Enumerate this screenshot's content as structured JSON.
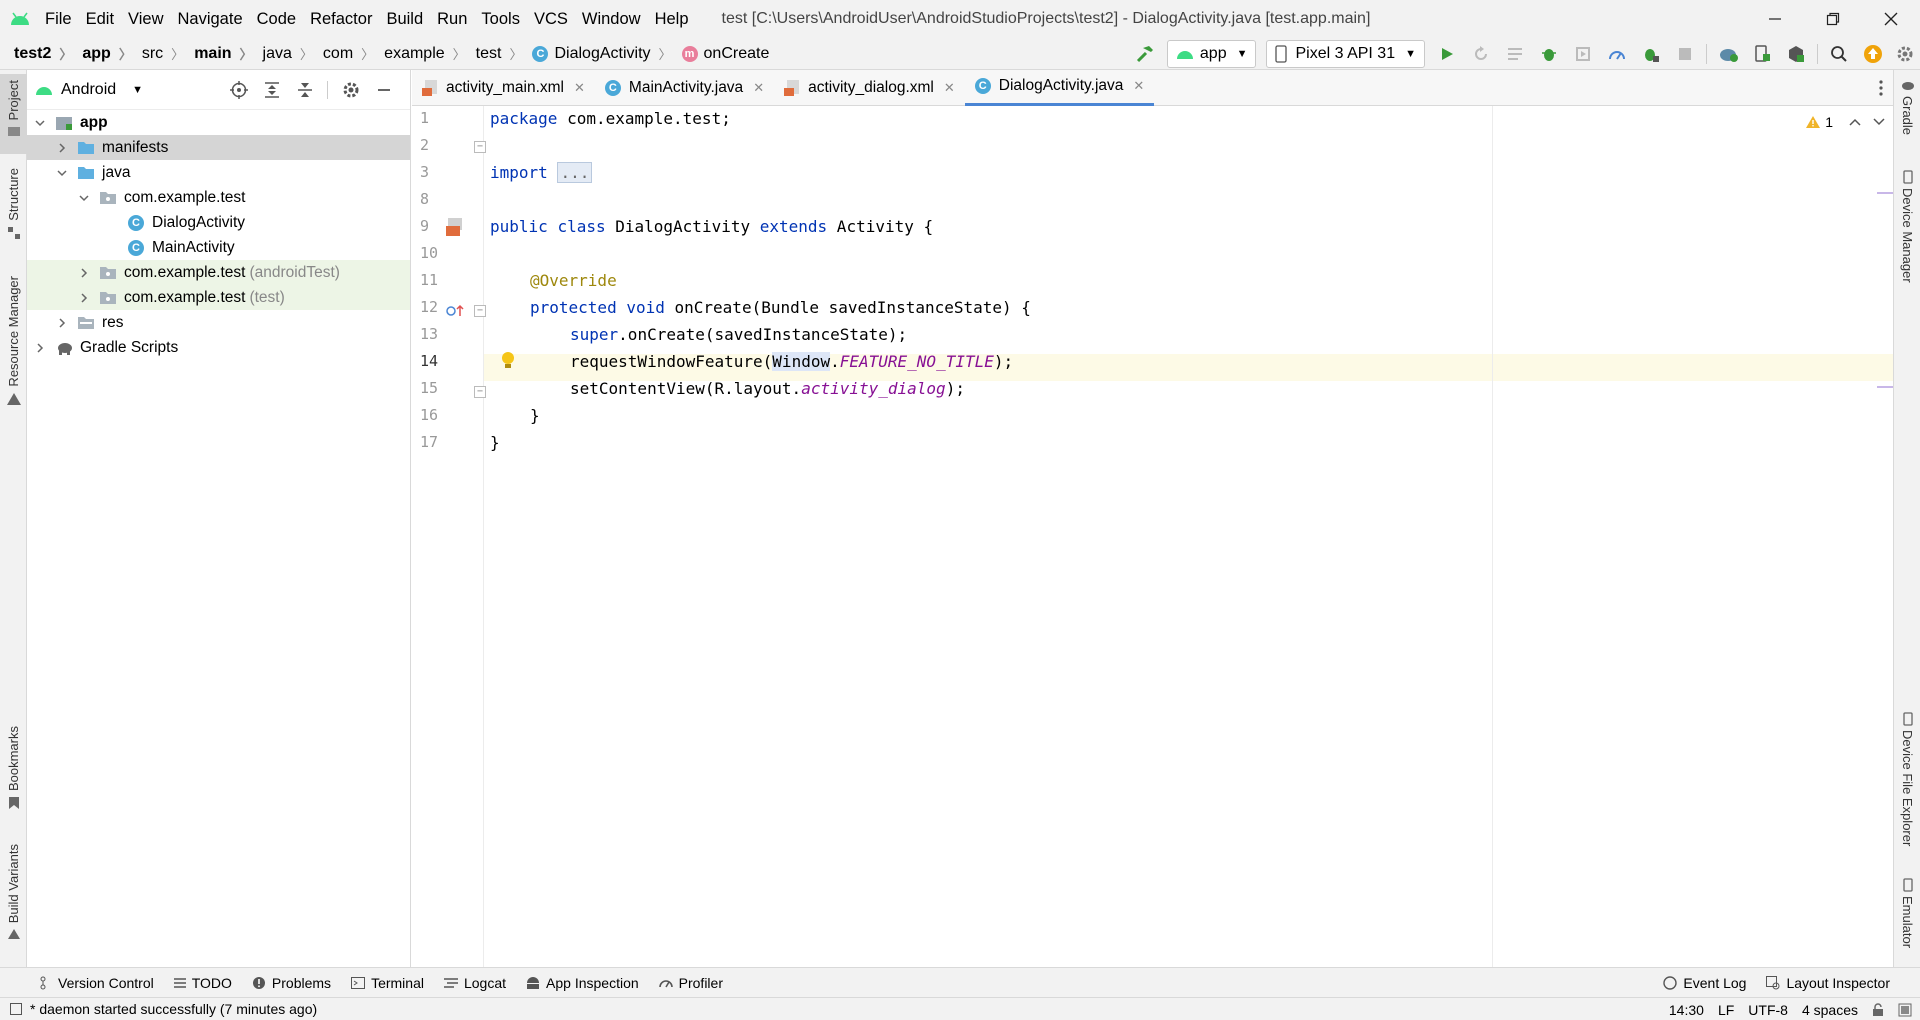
{
  "window": {
    "title": "test [C:\\Users\\AndroidUser\\AndroidStudioProjects\\test2] - DialogActivity.java [test.app.main]",
    "menu": [
      "File",
      "Edit",
      "View",
      "Navigate",
      "Code",
      "Refactor",
      "Build",
      "Run",
      "Tools",
      "VCS",
      "Window",
      "Help"
    ]
  },
  "breadcrumb": [
    "test2",
    "app",
    "src",
    "main",
    "java",
    "com",
    "example",
    "test",
    "DialogActivity",
    "onCreate"
  ],
  "toolbar": {
    "run_config": "app",
    "device": "Pixel 3 API 31"
  },
  "left_strip": {
    "project": "Project",
    "structure": "Structure",
    "resource_manager": "Resource Manager",
    "bookmarks": "Bookmarks",
    "build_variants": "Build Variants"
  },
  "right_strip": {
    "gradle": "Gradle",
    "device_manager": "Device Manager",
    "device_file_explorer": "Device File Explorer",
    "emulator": "Emulator"
  },
  "project_panel": {
    "view_name": "Android",
    "tree": [
      {
        "label": "app",
        "suffix": ""
      },
      {
        "label": "manifests",
        "suffix": ""
      },
      {
        "label": "java",
        "suffix": ""
      },
      {
        "label": "com.example.test",
        "suffix": ""
      },
      {
        "label": "DialogActivity",
        "suffix": ""
      },
      {
        "label": "MainActivity",
        "suffix": ""
      },
      {
        "label": "com.example.test",
        "suffix": "(androidTest)"
      },
      {
        "label": "com.example.test",
        "suffix": "(test)"
      },
      {
        "label": "res",
        "suffix": ""
      },
      {
        "label": "Gradle Scripts",
        "suffix": ""
      }
    ]
  },
  "editor_tabs": [
    "activity_main.xml",
    "MainActivity.java",
    "activity_dialog.xml",
    "DialogActivity.java"
  ],
  "editor": {
    "line_numbers": [
      "1",
      "2",
      "3",
      "8",
      "9",
      "10",
      "11",
      "12",
      "13",
      "14",
      "15",
      "16",
      "17"
    ],
    "code": {
      "l1_kw": "package",
      "l1_rest": " com.example.test;",
      "l3_kw": "import",
      "l3_fold": "...",
      "l9_kw1": "public",
      "l9_kw2": "class",
      "l9_mid": " DialogActivity ",
      "l9_kw3": "extends",
      "l9_rest": " Activity {",
      "l11_ann": "@Override",
      "l12_kw1": "protected",
      "l12_kw2": "void",
      "l12_rest": " onCreate(Bundle savedInstanceState) {",
      "l13_kw": "super",
      "l13_rest": ".onCreate(savedInstanceState);",
      "l14_a": "requestWindowFeature(",
      "l14_b": "Window",
      "l14_c": ".",
      "l14_fld": "FEATURE_NO_TITLE",
      "l14_d": ");",
      "l15_a": "setContentView(R.layout.",
      "l15_fld": "activity_dialog",
      "l15_b": ");",
      "l16": "}",
      "l17": "}"
    },
    "warning_count": "1"
  },
  "bottom_tabs": [
    "Version Control",
    "TODO",
    "Problems",
    "Terminal",
    "Logcat",
    "App Inspection",
    "Profiler"
  ],
  "bottom_right_tabs": [
    "Event Log",
    "Layout Inspector"
  ],
  "status": {
    "message": "* daemon started successfully (7 minutes ago)",
    "position": "14:30",
    "line_sep": "LF",
    "encoding": "UTF-8",
    "indent": "4 spaces"
  },
  "colors": {
    "accent": "#4a85d4",
    "android_green": "#3ddc84",
    "keyword": "#0033b3",
    "annotation": "#9e880d",
    "field": "#871094"
  }
}
